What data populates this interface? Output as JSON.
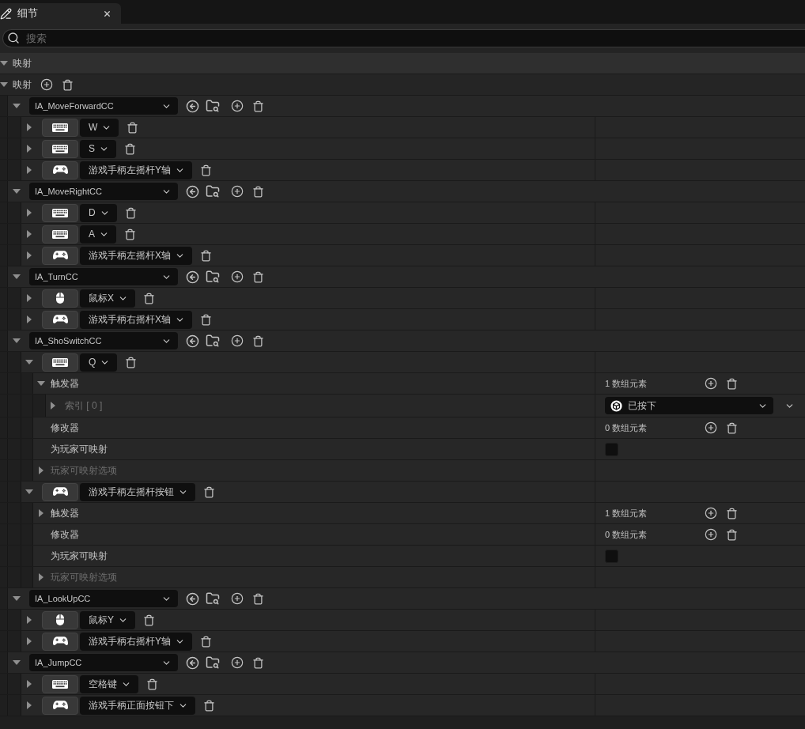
{
  "tab": {
    "title": "细节"
  },
  "search": {
    "placeholder": "搜索"
  },
  "category": {
    "label": "映射",
    "expanded": true
  },
  "mappings": {
    "label": "映射",
    "expanded": true,
    "groups": [
      {
        "action": "IA_MoveForwardCC",
        "expanded": true,
        "keys": [
          {
            "kind": "keyboard",
            "key": "W",
            "expanded": false
          },
          {
            "kind": "keyboard",
            "key": "S",
            "expanded": false
          },
          {
            "kind": "gamepad",
            "key": "游戏手柄左摇杆Y轴",
            "expanded": false
          }
        ]
      },
      {
        "action": "IA_MoveRightCC",
        "expanded": true,
        "keys": [
          {
            "kind": "keyboard",
            "key": "D",
            "expanded": false
          },
          {
            "kind": "keyboard",
            "key": "A",
            "expanded": false
          },
          {
            "kind": "gamepad",
            "key": "游戏手柄左摇杆X轴",
            "expanded": false
          }
        ]
      },
      {
        "action": "IA_TurnCC",
        "expanded": true,
        "keys": [
          {
            "kind": "mouse",
            "key": "鼠标X",
            "expanded": false
          },
          {
            "kind": "gamepad",
            "key": "游戏手柄右摇杆X轴",
            "expanded": false
          }
        ]
      },
      {
        "action": "IA_ShoSwitchCC",
        "expanded": true,
        "keys": [
          {
            "kind": "keyboard",
            "key": "Q",
            "expanded": true,
            "details": [
              {
                "kind": "array",
                "label": "触发器",
                "expanded": true,
                "disabled": false,
                "count": "1 数组元素",
                "items": [
                  {
                    "label": "索引 [ 0 ]",
                    "expanded": false,
                    "disabled": true,
                    "value": "已按下"
                  }
                ]
              },
              {
                "kind": "array",
                "label": "修改器",
                "disabled": false,
                "count": "0 数组元素"
              },
              {
                "kind": "checkbox",
                "label": "为玩家可映射",
                "disabled": false,
                "checked": false
              },
              {
                "kind": "section",
                "label": "玩家可映射选项",
                "expanded": false,
                "disabled": true
              }
            ]
          },
          {
            "kind": "gamepad",
            "key": "游戏手柄左摇杆按钮",
            "expanded": true,
            "details": [
              {
                "kind": "array",
                "label": "触发器",
                "expanded": false,
                "disabled": false,
                "count": "1 数组元素"
              },
              {
                "kind": "array",
                "label": "修改器",
                "disabled": false,
                "count": "0 数组元素"
              },
              {
                "kind": "checkbox",
                "label": "为玩家可映射",
                "disabled": false,
                "checked": false
              },
              {
                "kind": "section",
                "label": "玩家可映射选项",
                "expanded": false,
                "disabled": true
              }
            ]
          }
        ]
      },
      {
        "action": "IA_LookUpCC",
        "expanded": true,
        "keys": [
          {
            "kind": "mouse",
            "key": "鼠标Y",
            "expanded": false
          },
          {
            "kind": "gamepad",
            "key": "游戏手柄右摇杆Y轴",
            "expanded": false
          }
        ]
      },
      {
        "action": "IA_JumpCC",
        "expanded": true,
        "keys": [
          {
            "kind": "keyboard",
            "key": "空格键",
            "expanded": false
          },
          {
            "kind": "gamepad",
            "key": "游戏手柄正面按钮下",
            "expanded": false
          }
        ]
      }
    ]
  }
}
